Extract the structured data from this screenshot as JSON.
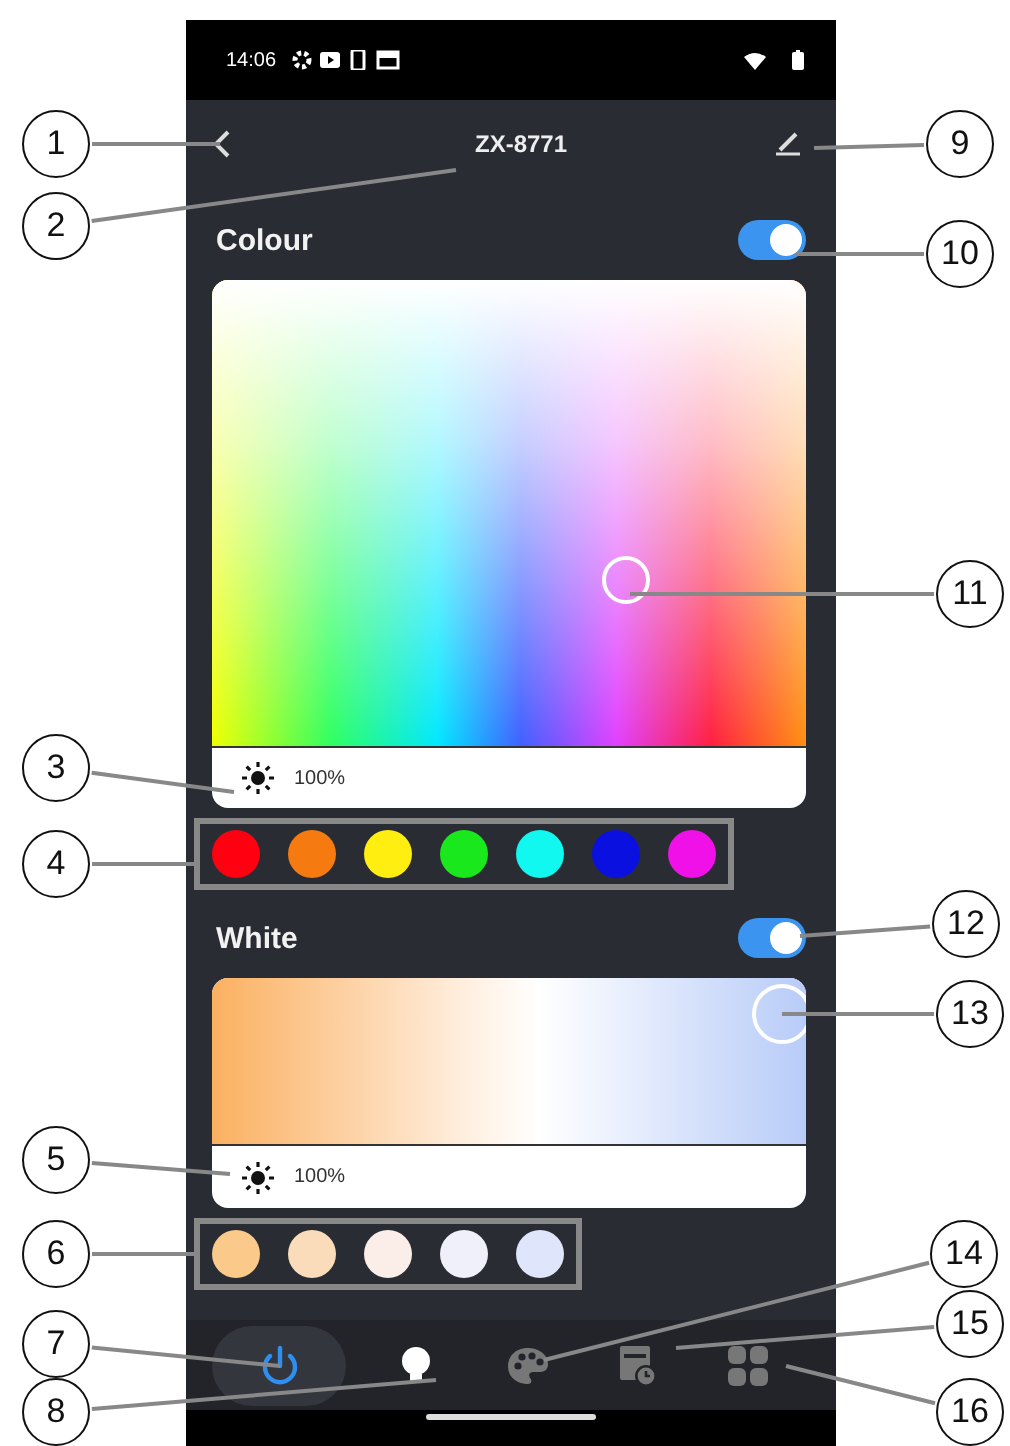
{
  "status_bar": {
    "time": "14:06"
  },
  "header": {
    "title": "ZX-8771"
  },
  "colour": {
    "title": "Colour",
    "on": true,
    "brightness": "100%",
    "swatches": [
      {
        "color": "#ff0010"
      },
      {
        "color": "#f57a10"
      },
      {
        "color": "#ffee10"
      },
      {
        "color": "#18e81c"
      },
      {
        "color": "#10f8f0"
      },
      {
        "color": "#0a10e0"
      },
      {
        "color": "#f010e8"
      }
    ]
  },
  "white": {
    "title": "White",
    "on": true,
    "brightness": "100%",
    "swatches": [
      {
        "color": "#fbc98a"
      },
      {
        "color": "#fbdcba"
      },
      {
        "color": "#fbeee8"
      },
      {
        "color": "#f0f0fb"
      },
      {
        "color": "#dfe6fb"
      }
    ]
  },
  "nav": [
    {
      "kind": "power",
      "selected": true
    },
    {
      "kind": "bulb",
      "selected": true
    },
    {
      "kind": "palette",
      "selected": false
    },
    {
      "kind": "schedule",
      "selected": false
    },
    {
      "kind": "scenes",
      "selected": false
    }
  ],
  "callouts": [
    {
      "label": "1"
    },
    {
      "label": "2"
    },
    {
      "label": "3"
    },
    {
      "label": "4"
    },
    {
      "label": "5"
    },
    {
      "label": "6"
    },
    {
      "label": "7"
    },
    {
      "label": "8"
    },
    {
      "label": "9"
    },
    {
      "label": "10"
    },
    {
      "label": "11"
    },
    {
      "label": "12"
    },
    {
      "label": "13"
    },
    {
      "label": "14"
    },
    {
      "label": "15"
    },
    {
      "label": "16"
    }
  ]
}
